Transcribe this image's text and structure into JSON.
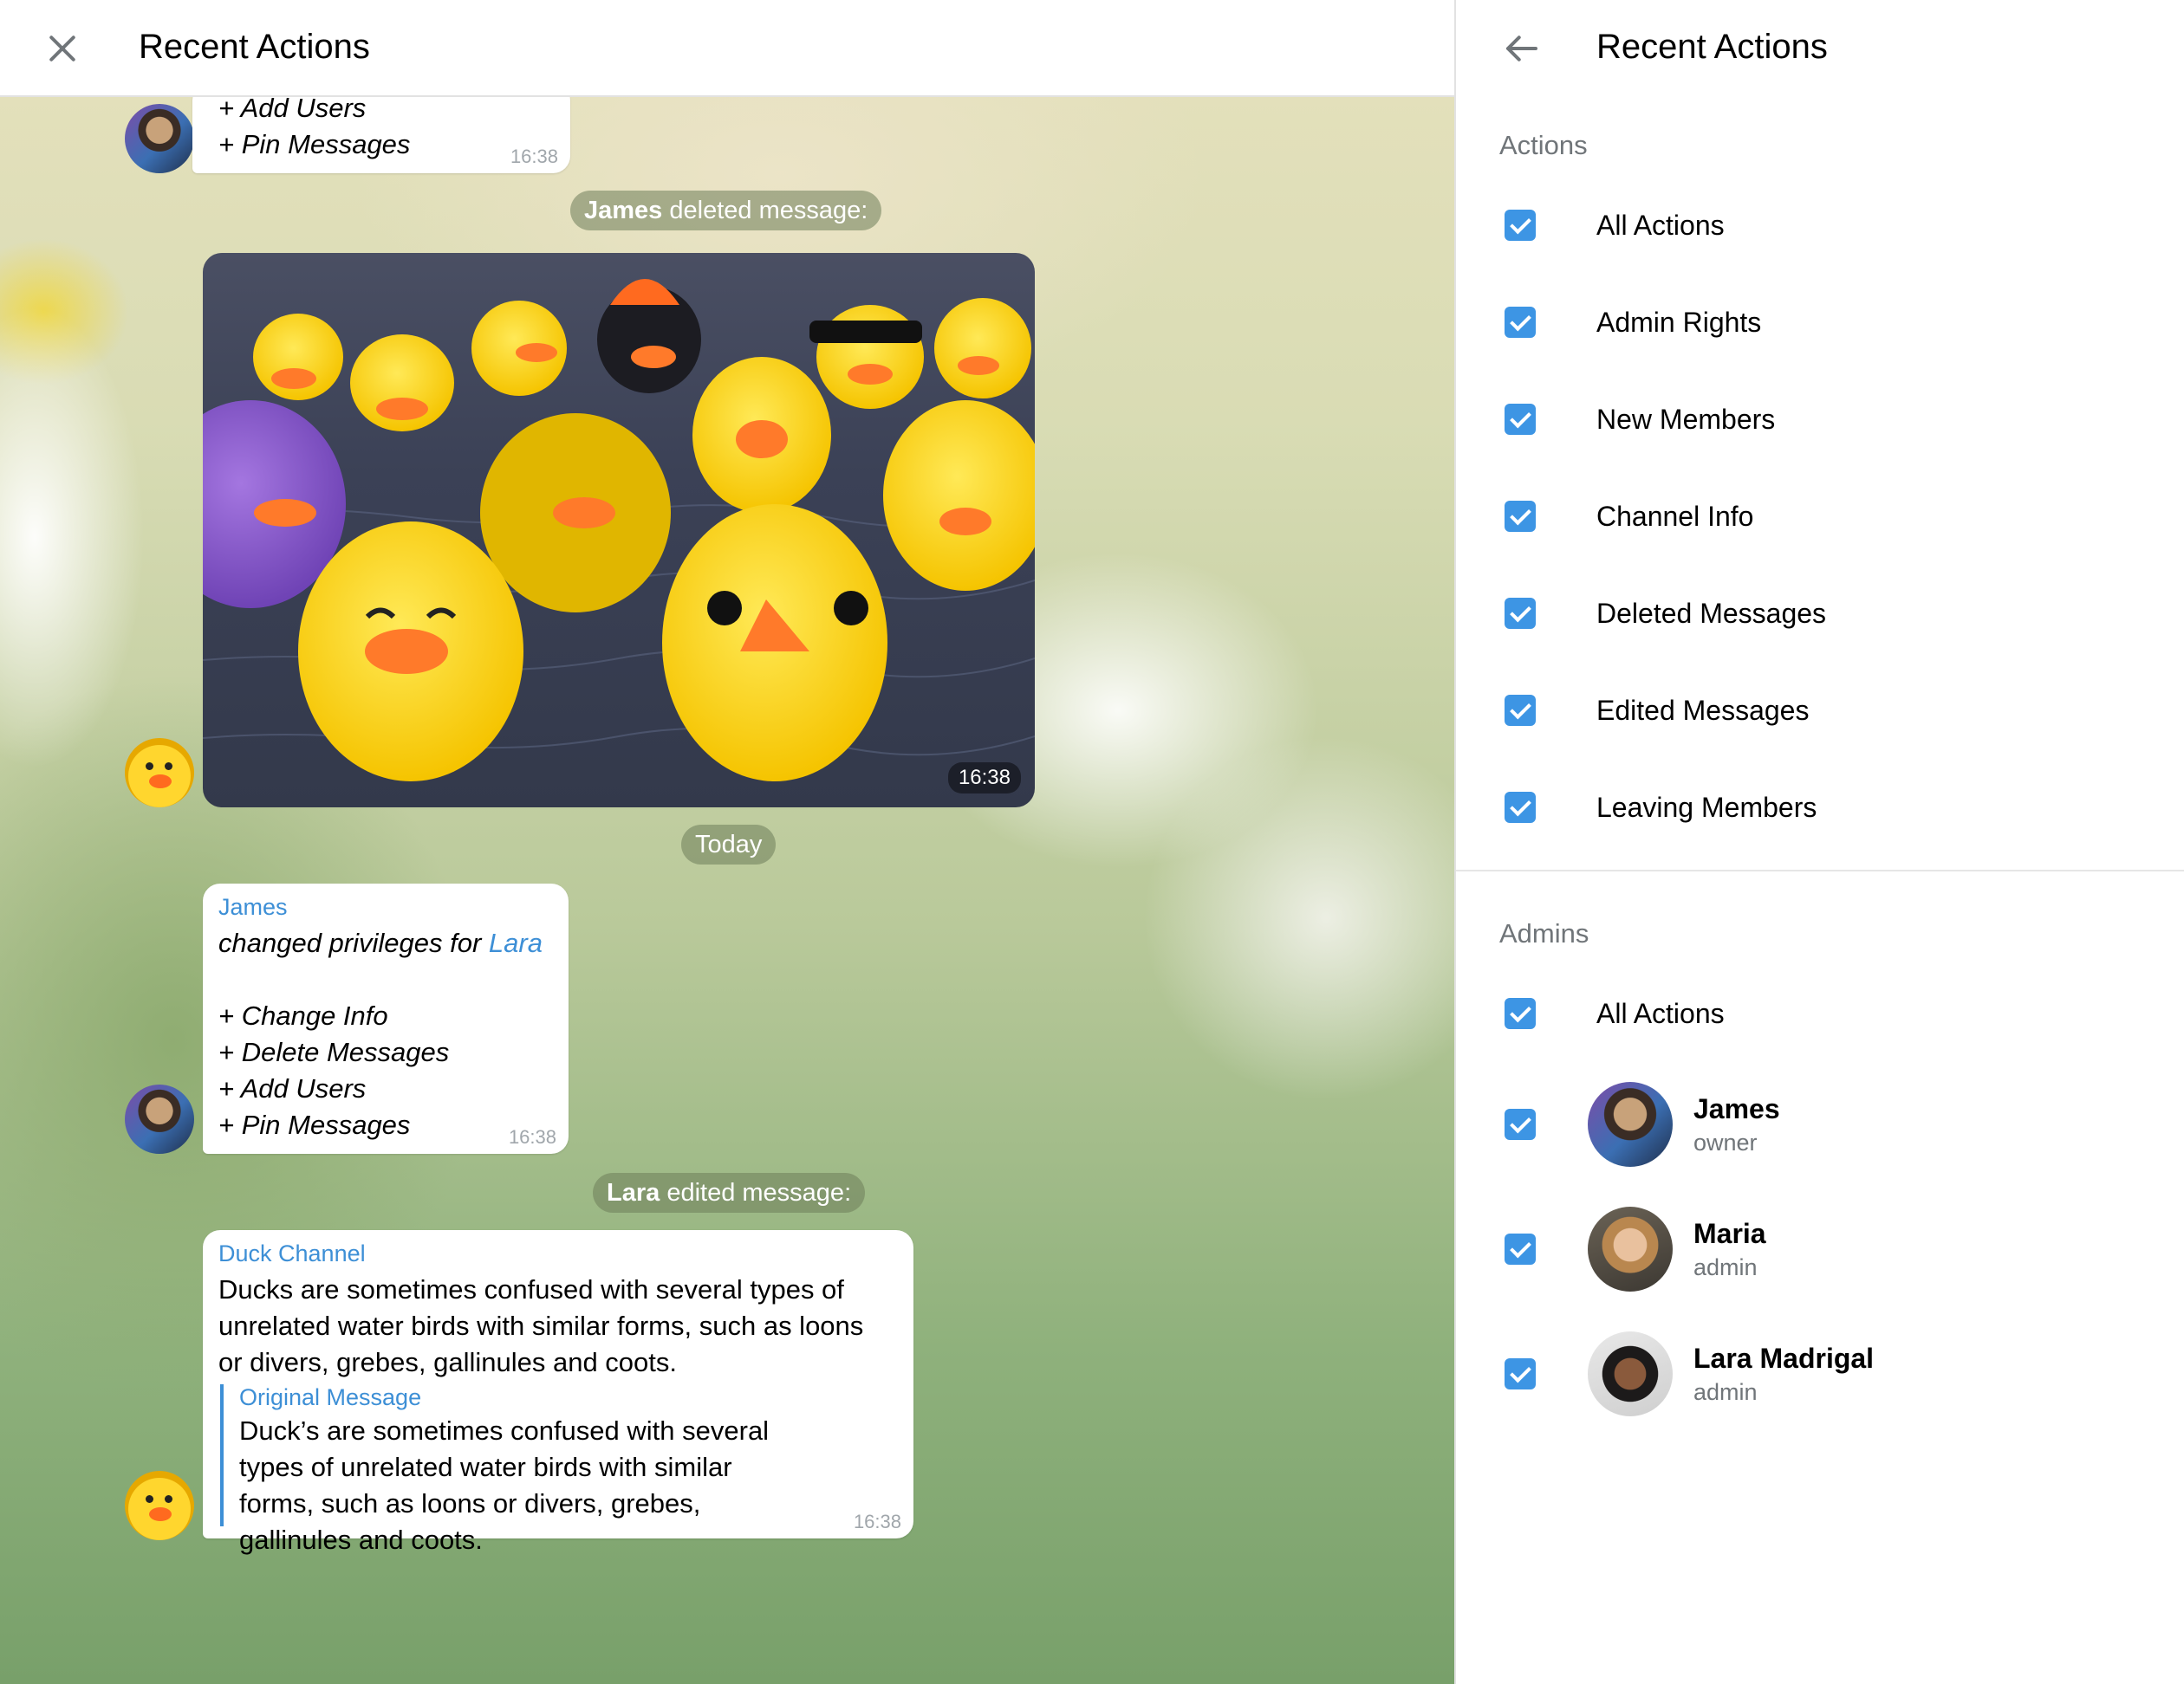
{
  "chat": {
    "title": "Recent Actions",
    "top_bubble": {
      "lines": [
        "+ Add Users",
        "+ Pin Messages"
      ],
      "time": "16:38"
    },
    "deleted_pill": {
      "actor": "James",
      "text": " deleted message:"
    },
    "media": {
      "time": "16:38"
    },
    "date_pill": "Today",
    "privileges_bubble": {
      "actor": "James",
      "action": "changed privileges for ",
      "target": "Lara",
      "lines": [
        "+ Change Info",
        "+ Delete Messages",
        "+ Add Users",
        "+ Pin Messages"
      ],
      "time": "16:38"
    },
    "edited_pill": {
      "actor": "Lara",
      "text": " edited message:"
    },
    "edited_bubble": {
      "channel": "Duck Channel",
      "text": "Ducks are sometimes confused with several types of unrelated water birds with similar forms, such as loons or divers, grebes, gallinules and coots.",
      "original_label": "Original Message",
      "original_text": "Duck’s are sometimes confused with several types of unrelated water birds with similar forms, such as loons or divers, grebes, gallinules and coots.",
      "time": "16:38"
    }
  },
  "panel": {
    "title": "Recent Actions",
    "actions_title": "Actions",
    "actions": [
      {
        "label": "All Actions",
        "checked": true
      },
      {
        "label": "Admin Rights",
        "checked": true
      },
      {
        "label": "New Members",
        "checked": true
      },
      {
        "label": "Channel Info",
        "checked": true
      },
      {
        "label": "Deleted Messages",
        "checked": true
      },
      {
        "label": "Edited Messages",
        "checked": true
      },
      {
        "label": "Leaving Members",
        "checked": true
      }
    ],
    "admins_title": "Admins",
    "admins_all": {
      "label": "All Actions",
      "checked": true
    },
    "admins": [
      {
        "name": "James",
        "role": "owner",
        "checked": true
      },
      {
        "name": "Maria",
        "role": "admin",
        "checked": true
      },
      {
        "name": "Lara Madrigal",
        "role": "admin",
        "checked": true
      }
    ]
  },
  "colors": {
    "accent": "#3d95e4",
    "link": "#3d8fd6",
    "muted": "#707579"
  }
}
